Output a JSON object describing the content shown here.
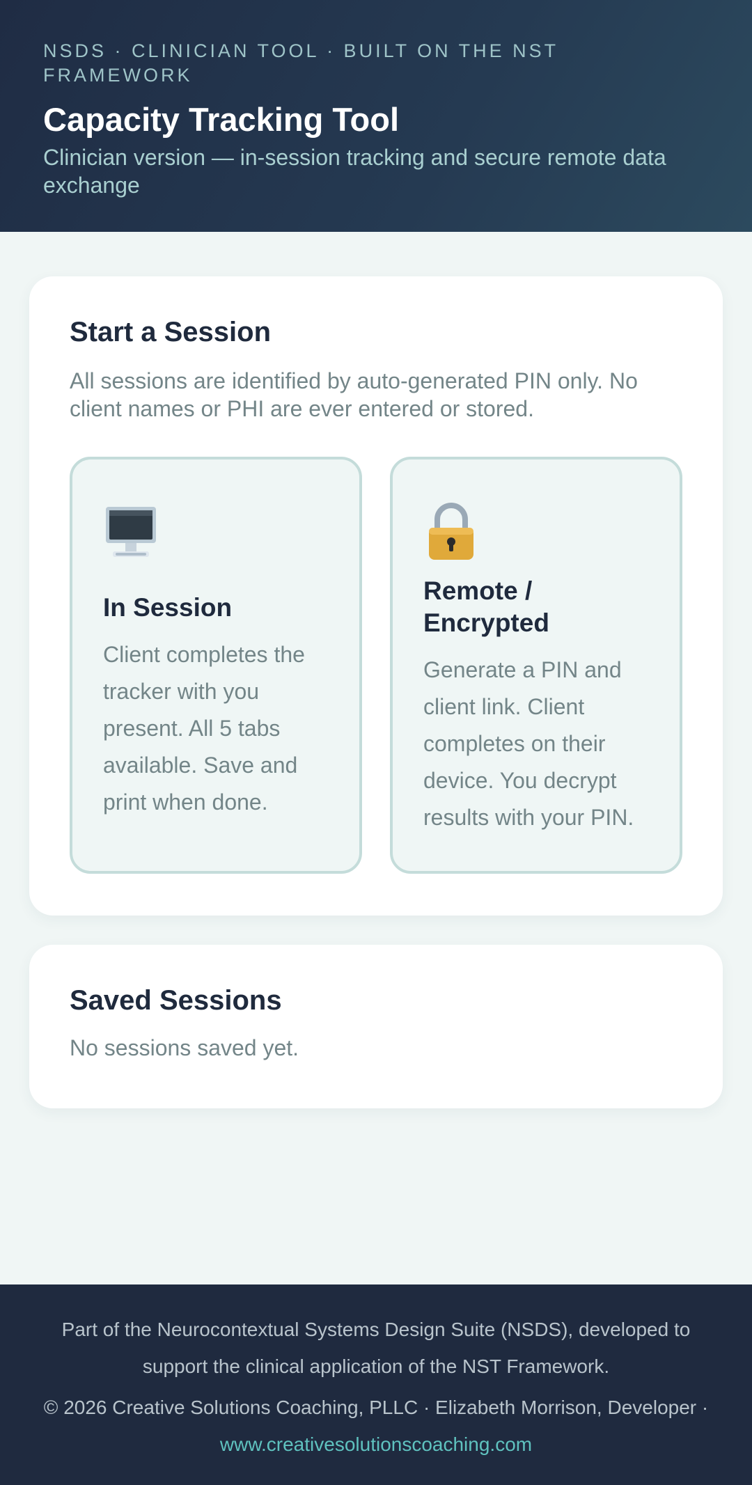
{
  "header": {
    "eyebrow": "NSDS · Clinician Tool · Built on the NST Framework",
    "title": "Capacity Tracking Tool",
    "subtitle": "Clinician version — in-session tracking and secure remote data exchange"
  },
  "start_session": {
    "heading": "Start a Session",
    "description": "All sessions are identified by auto-generated PIN only. No client names or PHI are ever entered or stored.",
    "options": [
      {
        "icon": "computer-monitor-icon",
        "title": "In Session",
        "body": "Client completes the tracker with you present. All 5 tabs available. Save and print when done."
      },
      {
        "icon": "padlock-icon",
        "title": "Remote / Encrypted",
        "body": "Generate a PIN and client link. Client completes on their device. You decrypt results with your PIN."
      }
    ]
  },
  "saved_sessions": {
    "heading": "Saved Sessions",
    "empty_text": "No sessions saved yet."
  },
  "footer": {
    "about": "Part of the Neurocontextual Systems Design Suite (NSDS), developed to support the clinical application of the NST Framework.",
    "copyright": "© 2026 Creative Solutions Coaching, PLLC · Elizabeth Morrison, Developer ·",
    "link": "www.creativesolutionscoaching.com"
  },
  "colors": {
    "header_bg": "#1f2c44",
    "accent_teal": "#5fc2bf",
    "page_bg": "#f0f6f5",
    "footer_bg": "#1f2a3f"
  }
}
